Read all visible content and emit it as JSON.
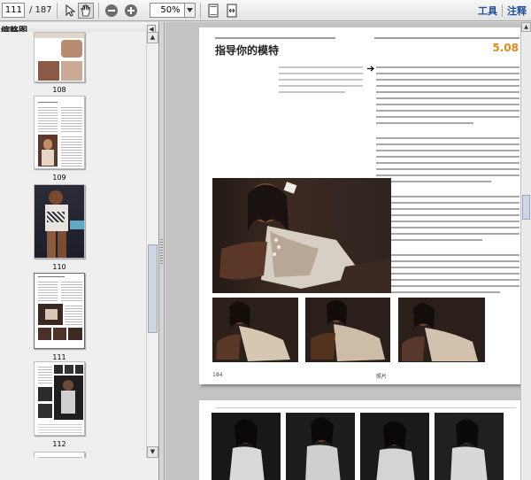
{
  "toolbar": {
    "current_page": "111",
    "page_total": "/ 187",
    "zoom": "50%",
    "tools_label": "工具",
    "comment_label": "注释"
  },
  "sidebar": {
    "title": "缩略图",
    "thumbnails": [
      {
        "label": "108"
      },
      {
        "label": "109"
      },
      {
        "label": "110"
      },
      {
        "label": "111"
      },
      {
        "label": "112"
      }
    ]
  },
  "page": {
    "title": "指导你的模特",
    "number": "5.08",
    "folio_left": "184",
    "folio_right": "照片"
  }
}
